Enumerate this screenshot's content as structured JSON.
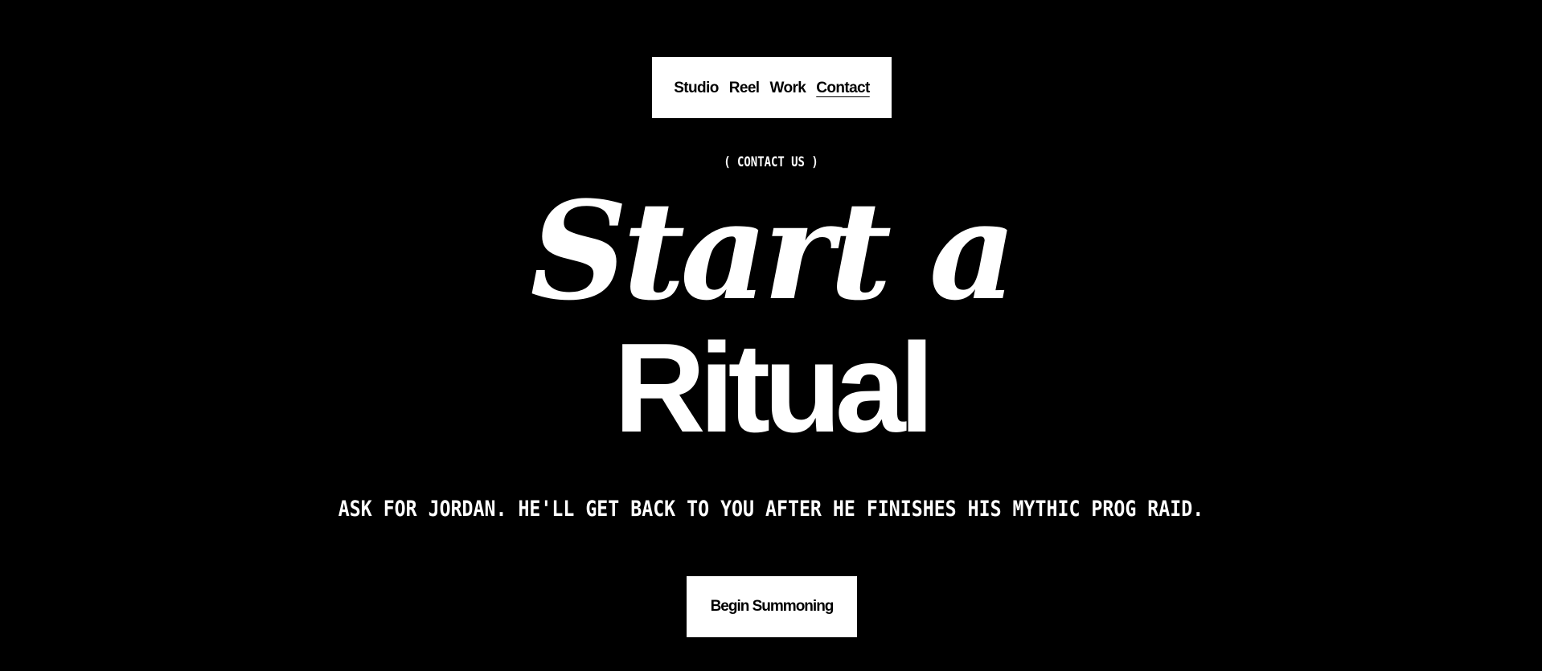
{
  "nav": {
    "items": [
      {
        "label": "Studio"
      },
      {
        "label": "Reel"
      },
      {
        "label": "Work"
      },
      {
        "label": "Contact"
      }
    ],
    "active": "Contact"
  },
  "hero": {
    "eyebrow": "( CONTACT US )",
    "headline_line1": "Start a",
    "headline_line2": "Ritual",
    "tagline": "ASK FOR JORDAN. HE'LL GET BACK TO YOU AFTER HE FINISHES HIS MYTHIC PROG RAID.",
    "cta_label": "Begin Summoning"
  },
  "colors": {
    "background": "#000000",
    "foreground": "#ffffff",
    "nav_background": "#ffffff",
    "nav_text": "#000000"
  }
}
